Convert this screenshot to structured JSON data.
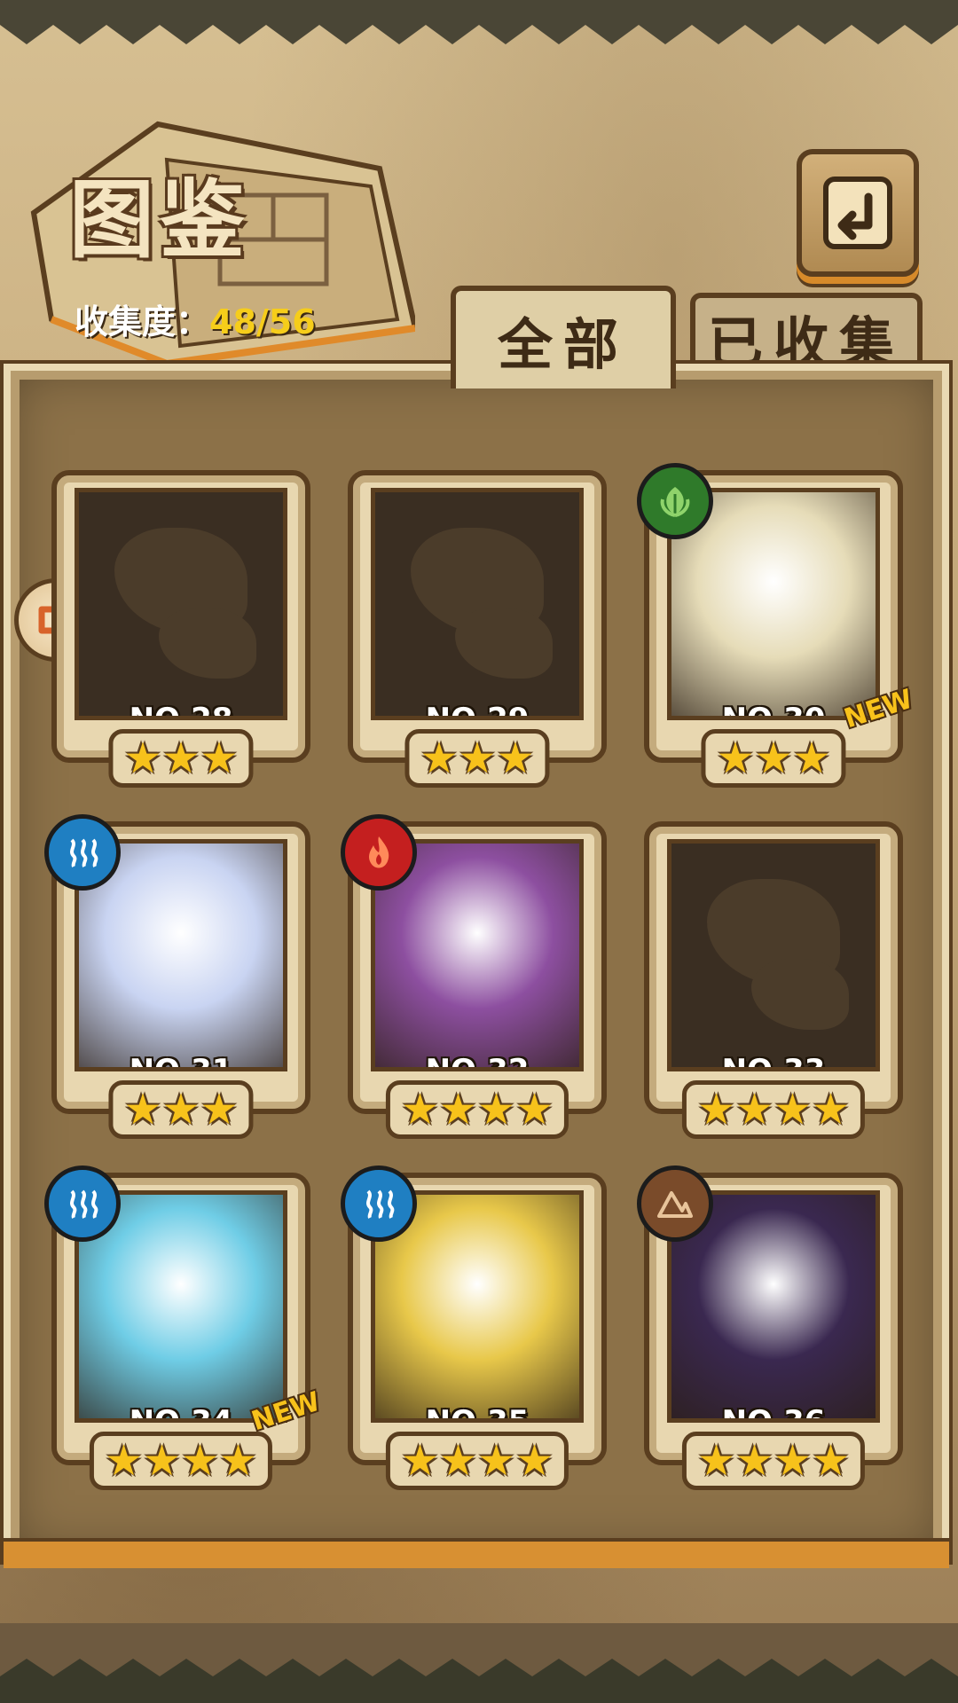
{
  "header": {
    "title": "图鉴",
    "collection_label": "收集度：",
    "collection_value": "48/56"
  },
  "tabs": [
    {
      "label": "全部",
      "selected": true
    },
    {
      "label": "已收集",
      "selected": false
    }
  ],
  "cards": [
    {
      "number": "NO.28",
      "stars": "★★★",
      "locked": true,
      "element": "",
      "element_color": "",
      "new": false
    },
    {
      "number": "NO.29",
      "stars": "★★★",
      "locked": true,
      "element": "",
      "element_color": "",
      "new": false
    },
    {
      "number": "NO.30",
      "stars": "★★★",
      "locked": false,
      "element": "leaf-icon",
      "element_color": "#2f7a2a",
      "new": true,
      "art_color": "#e6dcb8"
    },
    {
      "number": "NO.31",
      "stars": "★★★",
      "locked": false,
      "element": "water-icon",
      "element_color": "#1f7fc2",
      "new": false,
      "art_color": "#c9d4f2"
    },
    {
      "number": "NO.32",
      "stars": "★★★★",
      "locked": false,
      "element": "fire-icon",
      "element_color": "#c41f1f",
      "new": false,
      "art_color": "#8d4fa0"
    },
    {
      "number": "NO.33",
      "stars": "★★★★",
      "locked": true,
      "element": "",
      "element_color": "",
      "new": false
    },
    {
      "number": "NO.34",
      "stars": "★★★★",
      "locked": false,
      "element": "water-icon",
      "element_color": "#1f7fc2",
      "new": true,
      "art_color": "#6fcde6"
    },
    {
      "number": "NO.35",
      "stars": "★★★★",
      "locked": false,
      "element": "water-icon",
      "element_color": "#1f7fc2",
      "new": false,
      "art_color": "#e8c84a"
    },
    {
      "number": "NO.36",
      "stars": "★★★★",
      "locked": false,
      "element": "earth-icon",
      "element_color": "#7a4b2a",
      "new": false,
      "art_color": "#3a2850"
    }
  ],
  "new_label": "NEW",
  "colors": {
    "accent_yellow": "#f6cd1a",
    "frame_dark": "#5a3e1f",
    "panel": "#8c7148"
  }
}
